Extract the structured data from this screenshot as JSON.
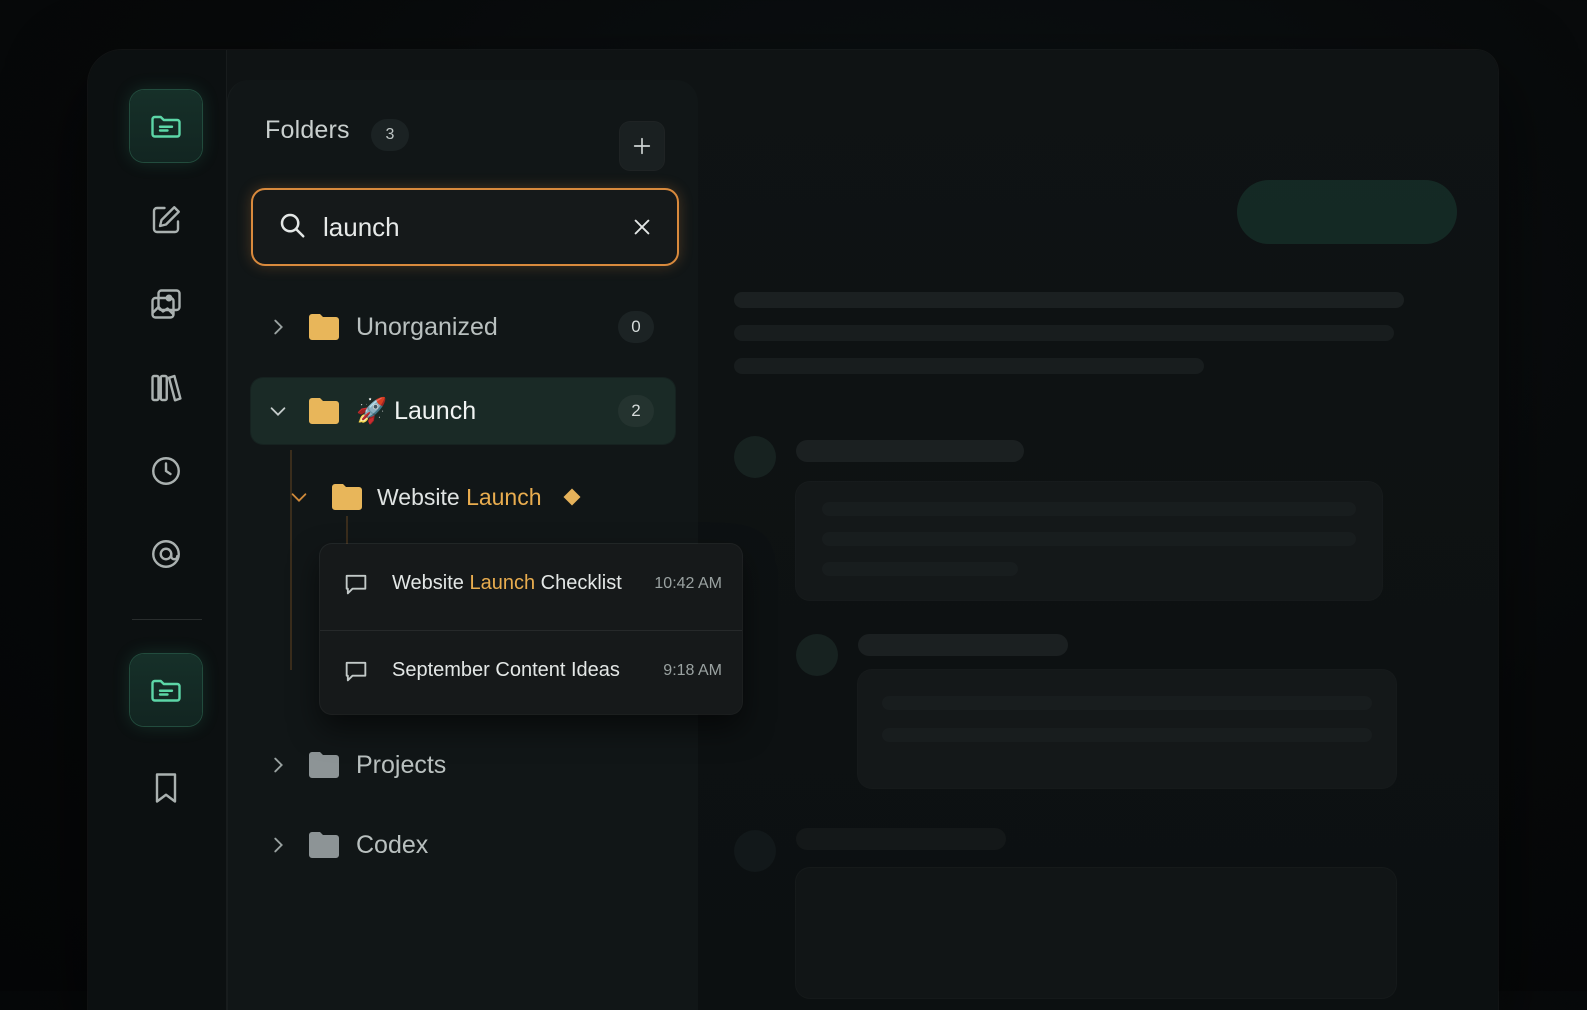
{
  "sidebar": {
    "icons": [
      "folder-list-icon",
      "compose-icon",
      "gallery-icon",
      "library-icon",
      "history-icon",
      "at-mention-icon",
      "folder-list-icon",
      "bookmark-icon"
    ]
  },
  "folders_panel": {
    "title": "Folders",
    "count": "3",
    "add_label": "+",
    "search": {
      "value": "launch",
      "placeholder": ""
    },
    "folders": [
      {
        "name": "Unorganized",
        "count": "0"
      },
      {
        "emoji": "🚀",
        "name": "Launch",
        "count": "2"
      },
      {
        "name_prefix": "Website ",
        "name_highlight": "Launch"
      },
      {
        "name": "Projects"
      },
      {
        "name": "Codex"
      }
    ],
    "results": [
      {
        "title_prefix": "Website ",
        "title_highlight": "Launch",
        "title_suffix": " Checklist",
        "time": "10:42 AM"
      },
      {
        "title": "September Content Ideas",
        "time": "9:18 AM"
      }
    ]
  },
  "colors": {
    "accent_green": "#5cd6a7",
    "highlight_orange": "#e9ad4f",
    "search_border": "#d98a3d",
    "folder_yellow": "#e8b65a",
    "folder_gray": "#8d9496"
  }
}
